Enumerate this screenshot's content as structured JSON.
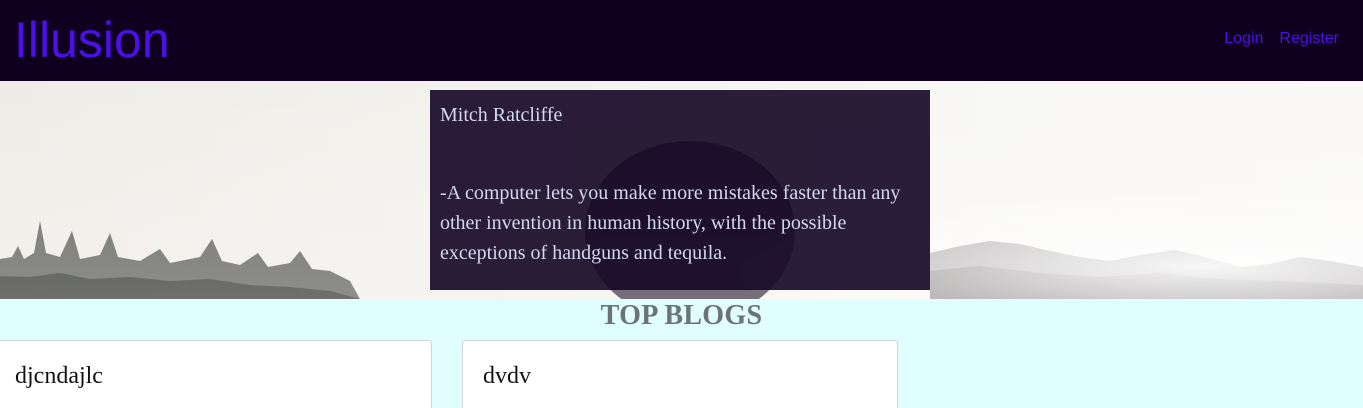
{
  "header": {
    "brand": "Illusion",
    "links": [
      "Login",
      "Register"
    ]
  },
  "hero": {
    "quote_author": "Mitch Ratcliffe",
    "quote_text": "-A computer lets you make more mistakes faster than any other invention in human history, with the possible exceptions of handguns and tequila."
  },
  "section": {
    "title": "TOP BLOGS"
  },
  "blogs": [
    {
      "title": "djcndajlc"
    },
    {
      "title": "dvdv"
    }
  ],
  "colors": {
    "nav_bg": "#100020",
    "brand": "#4a10e6",
    "page_bg": "#e0fefe",
    "quote_bg": "#180a28",
    "quote_text": "#d3d7f2"
  }
}
